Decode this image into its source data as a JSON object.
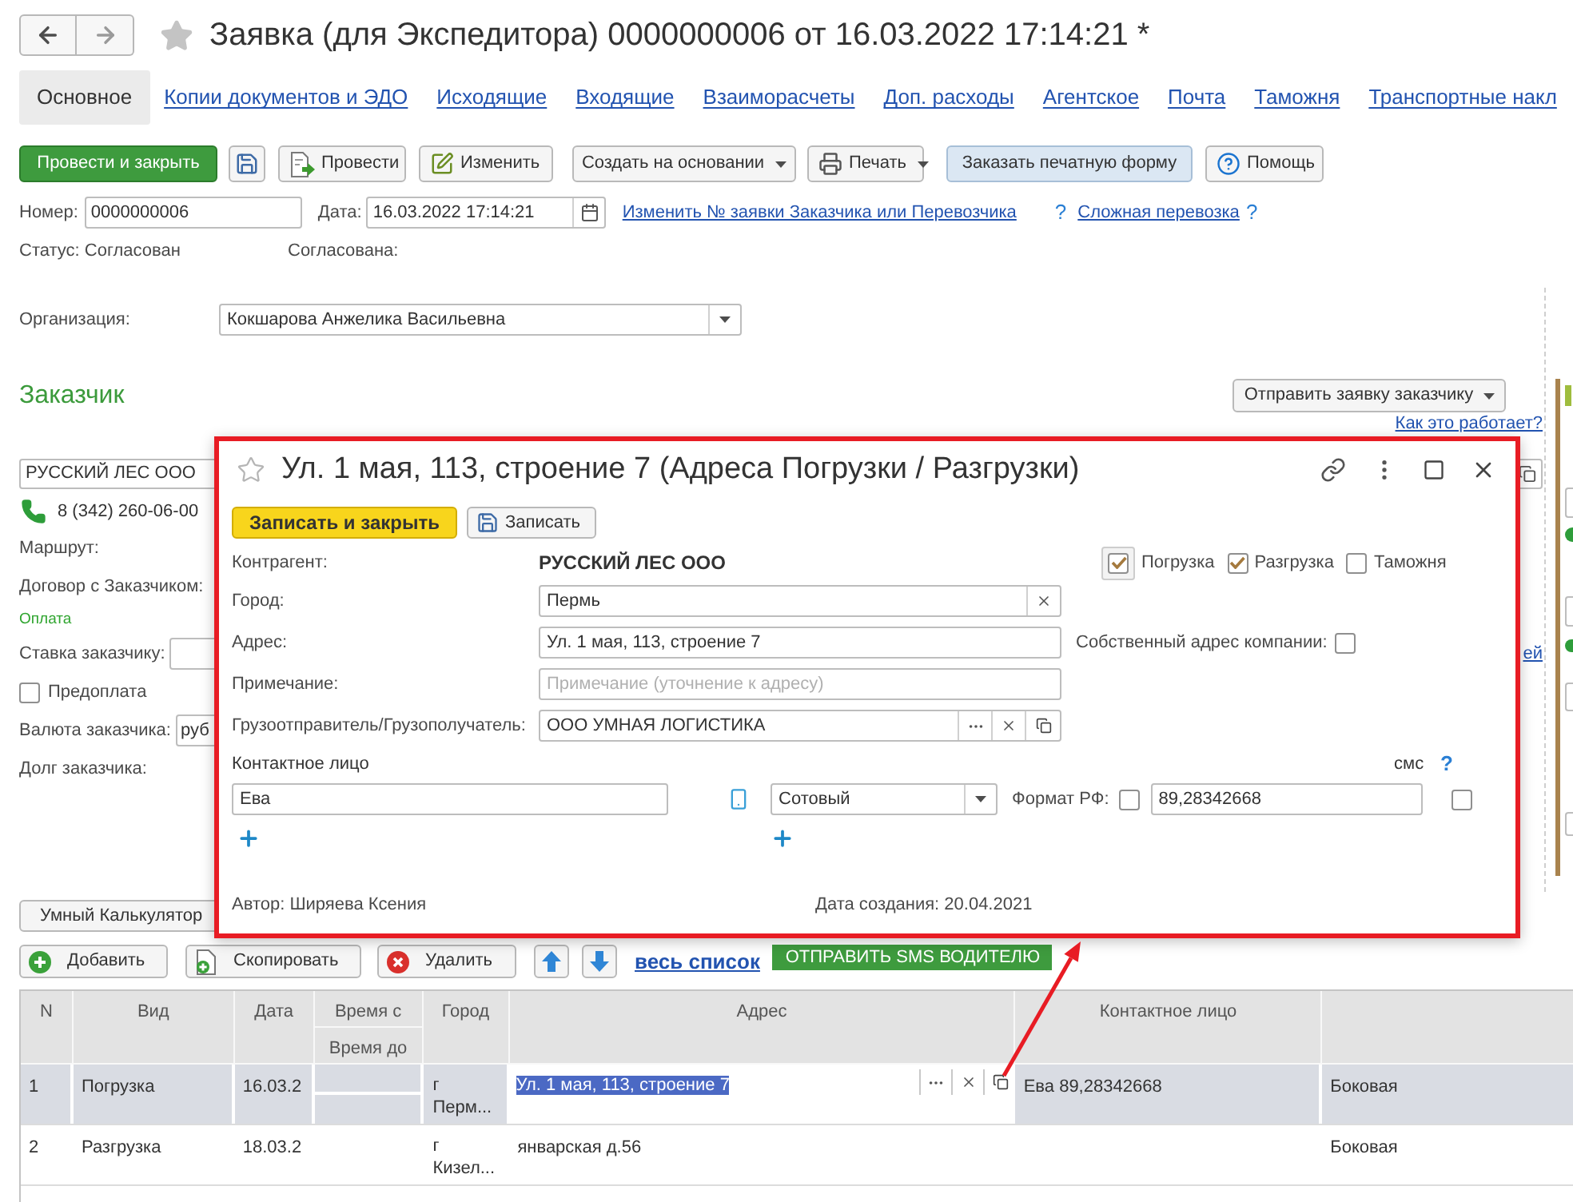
{
  "window": {
    "title": "Заявка (для Экспедитора) 0000000006 от 16.03.2022 17:14:21 *"
  },
  "tabs": [
    {
      "label": "Основное",
      "selected": true
    },
    {
      "label": "Копии документов и ЭДО",
      "selected": false
    },
    {
      "label": "Исходящие",
      "selected": false
    },
    {
      "label": "Входящие",
      "selected": false
    },
    {
      "label": "Взаиморасчеты",
      "selected": false
    },
    {
      "label": "Доп. расходы",
      "selected": false
    },
    {
      "label": "Агентское",
      "selected": false
    },
    {
      "label": "Почта",
      "selected": false
    },
    {
      "label": "Таможня",
      "selected": false
    },
    {
      "label": "Транспортные накл",
      "selected": false
    }
  ],
  "toolbar": [
    {
      "kind": "primary",
      "label": "Провести и закрыть"
    },
    {
      "kind": "save"
    },
    {
      "kind": "post",
      "label": "Провести"
    },
    {
      "kind": "edit",
      "label": "Изменить"
    },
    {
      "kind": "menu",
      "label": "Создать на основании"
    },
    {
      "kind": "print",
      "label": "Печать"
    },
    {
      "kind": "accent",
      "label": "Заказать печатную форму"
    },
    {
      "kind": "help",
      "label": "Помощь"
    }
  ],
  "number": {
    "label": "Номер:",
    "value": "0000000006"
  },
  "date": {
    "label": "Дата:",
    "value": "16.03.2022 17:14:21"
  },
  "links": [
    {
      "label": "Изменить № заявки Заказчика или Перевозчика",
      "help": "?"
    },
    {
      "label": "Сложная перевозка",
      "help": "?"
    }
  ],
  "status": {
    "label": "Статус: Согласован",
    "approved_label": "Согласована:"
  },
  "organization": {
    "label": "Организация:",
    "value": "Кокшарова Анжелика Васильевна"
  },
  "customer": {
    "heading": "Заказчик",
    "send_button": "Отправить заявку заказчику",
    "help_link": "Как это работает?",
    "name": "РУССКИЙ ЛЕС ООО",
    "phone": "8 (342) 260-06-00",
    "rows": [
      {
        "kind": "label",
        "label": "Маршрут:"
      },
      {
        "kind": "label",
        "label": "Договор с Заказчиком:"
      },
      {
        "kind": "section",
        "label": "Оплата"
      },
      {
        "kind": "field",
        "label": "Ставка заказчику:",
        "side_link": "ей"
      },
      {
        "kind": "checkbox",
        "label": "Предоплата",
        "checked": false
      },
      {
        "kind": "field",
        "label": "Валюта заказчика:",
        "value": "руб"
      },
      {
        "kind": "label",
        "label": "Долг заказчика:"
      }
    ]
  },
  "calculator_button": "Умный Калькулятор",
  "points_toolbar": {
    "buttons": [
      {
        "kind": "add",
        "label": "Добавить"
      },
      {
        "kind": "copy",
        "label": "Скопировать"
      },
      {
        "kind": "delete",
        "label": "Удалить"
      },
      {
        "kind": "up"
      },
      {
        "kind": "down"
      }
    ],
    "all_link": "весь список",
    "sms_button": "ОТПРАВИТЬ SMS ВОДИТЕЛЮ"
  },
  "table": {
    "columns": [
      {
        "label": "N"
      },
      {
        "label": "Вид"
      },
      {
        "label": "Дата"
      },
      {
        "label": "Время с",
        "sub_label": "Время до"
      },
      {
        "label": "Город"
      },
      {
        "label": "Адрес"
      },
      {
        "label": "Контактное лицо"
      }
    ],
    "rows": [
      {
        "n": "1",
        "type": "Погрузка",
        "date": "16.03.2",
        "city": "г Перм...",
        "address": "Ул. 1 мая, 113, строение 7",
        "contact": "Ева 89,28342668",
        "column_8": "Боковая",
        "selected": true,
        "editing": true
      },
      {
        "n": "2",
        "type": "Разгрузка",
        "date": "18.03.2",
        "city": "г Кизел...",
        "address": "январская д.56",
        "column_8": "Боковая",
        "selected": false,
        "editing": false
      }
    ]
  },
  "dialog": {
    "title": "Ул. 1 мая, 113, строение 7 (Адреса Погрузки / Разгрузки)",
    "buttons": [
      {
        "kind": "primary",
        "label": "Записать и закрыть"
      },
      {
        "kind": "save",
        "label": "Записать"
      }
    ],
    "counterparty": {
      "label": "Контрагент:",
      "value": "РУССКИЙ ЛЕС ООО"
    },
    "flags": [
      {
        "label": "Погрузка",
        "checked": true,
        "focused": true
      },
      {
        "label": "Разгрузка",
        "checked": true,
        "focused": false
      },
      {
        "label": "Таможня",
        "checked": false,
        "focused": false
      }
    ],
    "fields": [
      {
        "kind": "clearable",
        "label": "Город:",
        "value": "Пермь"
      },
      {
        "kind": "text",
        "label": "Адрес:",
        "value": "Ул. 1 мая, 113, строение 7",
        "option": {
          "label": "Собственный адрес компании:",
          "checked": false
        }
      },
      {
        "kind": "text",
        "label": "Примечание:",
        "placeholder": "Примечание (уточнение к адресу)"
      },
      {
        "kind": "reference",
        "label": "Грузоотправитель/Грузополучатель:",
        "value": "ООО УМНАЯ ЛОГИСТИКА"
      }
    ],
    "contact": {
      "heading": "Контактное лицо",
      "sms_label": "смс",
      "help": "?",
      "name": "Ева",
      "phone_type": "Сотовый",
      "format_label": "Формат РФ:",
      "format_checked": false,
      "phone": "89,28342668",
      "sms_checked": false
    },
    "author": "Автор: Ширяева Ксения",
    "created": "Дата создания: 20.04.2021"
  }
}
